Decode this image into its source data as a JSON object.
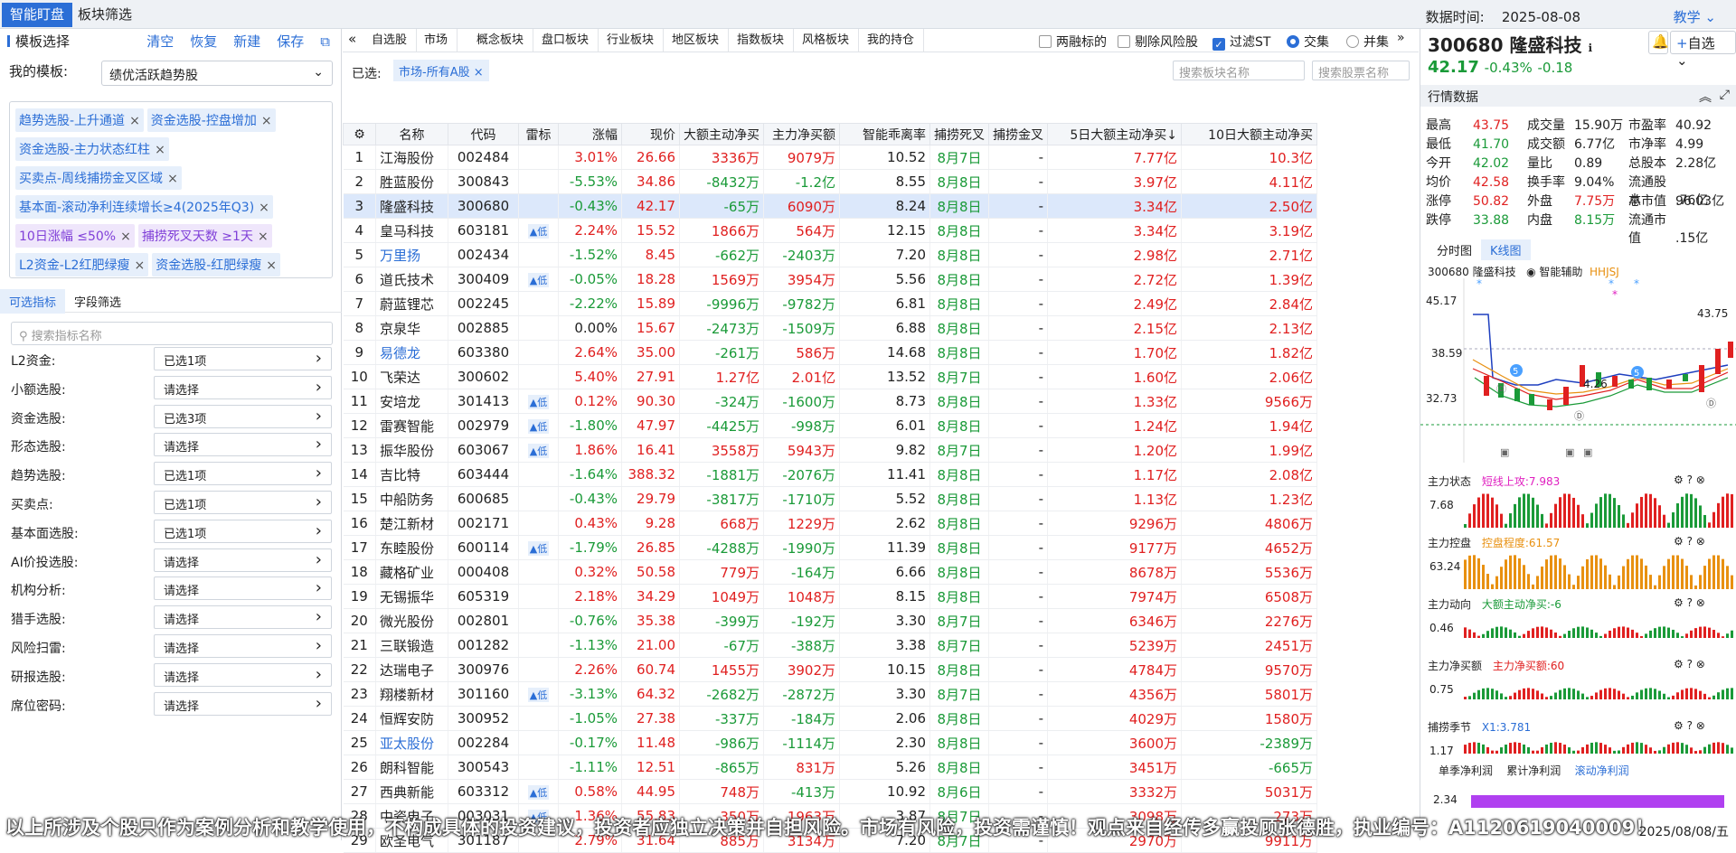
{
  "topbar": {
    "tabs": [
      "智能盯盘",
      "板块筛选"
    ],
    "date_label": "数据时间:",
    "date": "2025-08-08",
    "teach": "教学"
  },
  "left": {
    "title": "模板选择",
    "actions": [
      "清空",
      "恢复",
      "新建",
      "保存"
    ],
    "my_template_label": "我的模板:",
    "my_template_value": "绩优活跃趋势股",
    "tags": [
      {
        "t": "趋势选股-上升通道",
        "p": false
      },
      {
        "t": "资金选股-控盘增加",
        "p": false
      },
      {
        "t": "资金选股-主力状态红柱",
        "p": false
      },
      {
        "t": "买卖点-周线捕捞金叉区域",
        "p": false
      },
      {
        "t": "基本面-滚动净利连续增长≥4(2025年Q3)",
        "p": false
      },
      {
        "t": "10日涨幅 ≤50%",
        "p": true
      },
      {
        "t": "捕捞死叉天数 ≥1天",
        "p": true
      },
      {
        "t": "L2资金-L2红肥绿瘦",
        "p": false
      },
      {
        "t": "资金选股-红肥绿瘦",
        "p": false
      }
    ],
    "subtabs": [
      "可选指标",
      "字段筛选"
    ],
    "search_placeholder": "搜索指标名称",
    "filters": [
      [
        "L2资金:",
        "已选1项"
      ],
      [
        "小额选股:",
        "请选择"
      ],
      [
        "资金选股:",
        "已选3项"
      ],
      [
        "形态选股:",
        "请选择"
      ],
      [
        "趋势选股:",
        "已选1项"
      ],
      [
        "买卖点:",
        "已选1项"
      ],
      [
        "基本面选股:",
        "已选1项"
      ],
      [
        "AI价投选股:",
        "请选择"
      ],
      [
        "机构分析:",
        "请选择"
      ],
      [
        "猎手选股:",
        "请选择"
      ],
      [
        "风险扫雷:",
        "请选择"
      ],
      [
        "研报选股:",
        "请选择"
      ],
      [
        "席位密码:",
        "请选择"
      ]
    ]
  },
  "nav": {
    "tabs": [
      "自选股",
      "市场",
      "概念板块",
      "盘口板块",
      "行业板块",
      "地区板块",
      "指数板块",
      "风格板块",
      "我的持仓"
    ],
    "opts": [
      "两融标的",
      "剔除风险股",
      "过滤ST",
      "交集",
      "并集"
    ]
  },
  "selected": {
    "label": "已选:",
    "chip": "市场-所有A股",
    "search1": "搜索板块名称",
    "search2": "搜索股票名称"
  },
  "table": {
    "headers": [
      "",
      "名称",
      "代码",
      "雷标",
      "涨幅",
      "现价",
      "大额主动净买",
      "主力净买额",
      "智能乖离率",
      "捕捞死叉",
      "捕捞金叉",
      "5日大额主动净买↓",
      "10日大额主动净买"
    ],
    "rows": [
      [
        "1",
        "江海股份",
        "002484",
        "",
        "3.01%",
        "26.66",
        "3336万",
        "9079万",
        "10.52",
        "8月7日",
        "-",
        "7.77亿",
        "10.3亿"
      ],
      [
        "2",
        "胜蓝股份",
        "300843",
        "",
        "-5.53%",
        "34.86",
        "-8432万",
        "-1.2亿",
        "8.55",
        "8月8日",
        "-",
        "3.97亿",
        "4.11亿"
      ],
      [
        "3",
        "隆盛科技",
        "300680",
        "",
        "-0.43%",
        "42.17",
        "-65万",
        "6090万",
        "8.24",
        "8月8日",
        "-",
        "3.34亿",
        "2.50亿"
      ],
      [
        "4",
        "皇马科技",
        "603181",
        "低",
        "2.24%",
        "15.52",
        "1866万",
        "564万",
        "12.15",
        "8月8日",
        "-",
        "3.34亿",
        "3.19亿"
      ],
      [
        "5",
        "万里扬",
        "002434",
        "",
        "-1.52%",
        "8.45",
        "-662万",
        "-2403万",
        "7.20",
        "8月8日",
        "-",
        "2.98亿",
        "2.71亿"
      ],
      [
        "6",
        "道氏技术",
        "300409",
        "低",
        "-0.05%",
        "18.28",
        "1569万",
        "3954万",
        "5.56",
        "8月8日",
        "-",
        "2.72亿",
        "1.39亿"
      ],
      [
        "7",
        "蔚蓝锂芯",
        "002245",
        "",
        "-2.22%",
        "15.89",
        "-9996万",
        "-9782万",
        "6.81",
        "8月8日",
        "-",
        "2.49亿",
        "2.84亿"
      ],
      [
        "8",
        "京泉华",
        "002885",
        "",
        "0.00%",
        "15.67",
        "-2473万",
        "-1509万",
        "6.88",
        "8月8日",
        "-",
        "2.15亿",
        "2.13亿"
      ],
      [
        "9",
        "易德龙",
        "603380",
        "",
        "2.64%",
        "35.00",
        "-261万",
        "586万",
        "14.68",
        "8月8日",
        "-",
        "1.70亿",
        "1.82亿"
      ],
      [
        "10",
        "飞荣达",
        "300602",
        "",
        "5.40%",
        "27.91",
        "1.27亿",
        "2.01亿",
        "13.52",
        "8月7日",
        "-",
        "1.60亿",
        "2.06亿"
      ],
      [
        "11",
        "安培龙",
        "301413",
        "低",
        "0.12%",
        "90.30",
        "-324万",
        "-1600万",
        "8.73",
        "8月8日",
        "-",
        "1.33亿",
        "9566万"
      ],
      [
        "12",
        "雷赛智能",
        "002979",
        "低",
        "-1.80%",
        "47.97",
        "-4425万",
        "-998万",
        "6.01",
        "8月8日",
        "-",
        "1.24亿",
        "1.94亿"
      ],
      [
        "13",
        "振华股份",
        "603067",
        "低",
        "1.86%",
        "16.41",
        "3558万",
        "5943万",
        "9.82",
        "8月7日",
        "-",
        "1.20亿",
        "1.99亿"
      ],
      [
        "14",
        "吉比特",
        "603444",
        "",
        "-1.64%",
        "388.32",
        "-1881万",
        "-2076万",
        "11.41",
        "8月8日",
        "-",
        "1.17亿",
        "2.08亿"
      ],
      [
        "15",
        "中船防务",
        "600685",
        "",
        "-0.43%",
        "29.79",
        "-3817万",
        "-1710万",
        "5.52",
        "8月8日",
        "-",
        "1.13亿",
        "1.23亿"
      ],
      [
        "16",
        "楚江新材",
        "002171",
        "",
        "0.43%",
        "9.28",
        "668万",
        "1229万",
        "2.62",
        "8月8日",
        "-",
        "9296万",
        "4806万"
      ],
      [
        "17",
        "东睦股份",
        "600114",
        "低",
        "-1.79%",
        "26.85",
        "-4288万",
        "-1990万",
        "11.39",
        "8月8日",
        "-",
        "9177万",
        "4652万"
      ],
      [
        "18",
        "藏格矿业",
        "000408",
        "",
        "0.32%",
        "50.58",
        "779万",
        "-164万",
        "6.66",
        "8月8日",
        "-",
        "8678万",
        "5536万"
      ],
      [
        "19",
        "无锡振华",
        "605319",
        "",
        "2.18%",
        "34.29",
        "1049万",
        "1048万",
        "8.15",
        "8月8日",
        "-",
        "7974万",
        "6508万"
      ],
      [
        "20",
        "微光股份",
        "002801",
        "",
        "-0.76%",
        "35.38",
        "-399万",
        "-192万",
        "3.30",
        "8月7日",
        "-",
        "6346万",
        "2276万"
      ],
      [
        "21",
        "三联锻造",
        "001282",
        "",
        "-1.13%",
        "21.00",
        "-67万",
        "-388万",
        "3.38",
        "8月7日",
        "-",
        "5239万",
        "2451万"
      ],
      [
        "22",
        "达瑞电子",
        "300976",
        "",
        "2.26%",
        "60.74",
        "1455万",
        "3902万",
        "10.15",
        "8月8日",
        "-",
        "4784万",
        "9570万"
      ],
      [
        "23",
        "翔楼新材",
        "301160",
        "低",
        "-3.13%",
        "64.32",
        "-2682万",
        "-2872万",
        "3.30",
        "8月7日",
        "-",
        "4356万",
        "5801万"
      ],
      [
        "24",
        "恒辉安防",
        "300952",
        "",
        "-1.05%",
        "27.38",
        "-337万",
        "-184万",
        "2.06",
        "8月8日",
        "-",
        "4029万",
        "1580万"
      ],
      [
        "25",
        "亚太股份",
        "002284",
        "",
        "-0.17%",
        "11.48",
        "-986万",
        "-1114万",
        "2.30",
        "8月8日",
        "-",
        "3600万",
        "-2389万"
      ],
      [
        "26",
        "朗科智能",
        "300543",
        "",
        "-1.11%",
        "12.51",
        "-865万",
        "831万",
        "5.26",
        "8月8日",
        "-",
        "3451万",
        "-665万"
      ],
      [
        "27",
        "西典新能",
        "603312",
        "低",
        "0.58%",
        "44.95",
        "748万",
        "-413万",
        "10.92",
        "8月6日",
        "-",
        "3332万",
        "5031万"
      ],
      [
        "28",
        "中瓷电子",
        "003031",
        "低",
        "1.36%",
        "55.83",
        "350万",
        "1963万",
        "3.87",
        "8月7日",
        "-",
        "3098万",
        "273万"
      ],
      [
        "29",
        "欧圣电气",
        "301187",
        "",
        "2.79%",
        "31.64",
        "885万",
        "3134万",
        "7.20",
        "8月7日",
        "-",
        "2970万",
        "9911万"
      ]
    ]
  },
  "right": {
    "code": "300680",
    "name": "隆盛科技",
    "price": "42.17",
    "chg": "-0.43%",
    "chgv": "-0.18",
    "watch": "自选",
    "quote_title": "行情数据",
    "quotes": [
      [
        "最高",
        "43.75",
        "成交量",
        "15.90万",
        "市盈率",
        "40.92"
      ],
      [
        "最低",
        "41.70",
        "成交额",
        "6.77亿",
        "市净率",
        "4.99"
      ],
      [
        "今开",
        "42.02",
        "量比",
        "0.89",
        "总股本",
        "2.28亿"
      ],
      [
        "均价",
        "42.58",
        "换手率",
        "9.04%",
        "流通股本",
        ".76亿"
      ],
      [
        "涨停",
        "50.82",
        "外盘",
        "7.75万",
        "总市值",
        "96.03亿"
      ],
      [
        "跌停",
        "33.88",
        "内盘",
        "8.15万",
        "流通市值",
        ".15亿"
      ]
    ],
    "chart_tabs": [
      "分时图",
      "K线图"
    ],
    "chart_header": "300680 隆盛科技",
    "assist": "智能辅助",
    "hhs": "HHJSJ",
    "k_labels": [
      "45.17",
      "38.59",
      "32.73",
      "43.75",
      "4.26"
    ],
    "indicators": [
      [
        "主力状态",
        "短线上攻:7.983",
        "7.68"
      ],
      [
        "主力控盘",
        "控盘程度:61.57",
        "63.24"
      ],
      [
        "主力动向",
        "大额主动净买:-6",
        "0.46"
      ],
      [
        "主力净买额",
        "主力净买额:60",
        "0.75"
      ],
      [
        "捕捞季节",
        "X1:3.781",
        "1.17"
      ]
    ],
    "profit_tabs": [
      "单季净利润",
      "累计净利润",
      "滚动净利润"
    ],
    "profit_val": "2.34"
  },
  "footer": {
    "disclaimer": "以上所涉及个股只作为案例分析和教学使用，不构成具体的投资建议，投资者应独立决策并自担风险。市场有风险，投资需谨慎！观点来自经传多赢投顾张德胜，执业编号：A1120619040009！",
    "date": "2025/08/08/五"
  },
  "colors": {
    "accent": "#2b6ed6",
    "up": "#e02020",
    "down": "#1a9a38"
  }
}
